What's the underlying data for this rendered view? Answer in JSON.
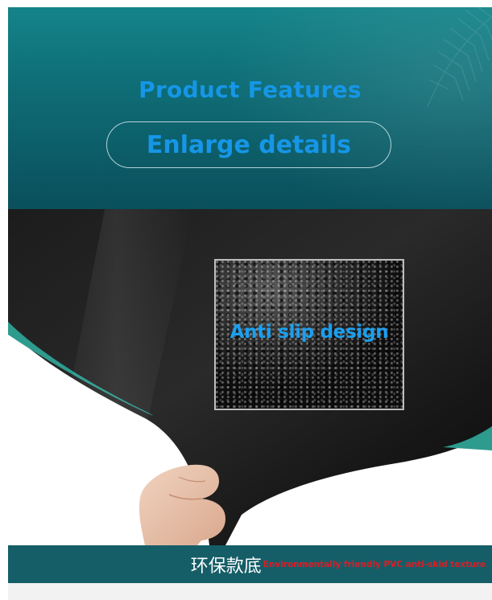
{
  "header": {
    "title": "Product Features",
    "pill_label": "Enlarge details"
  },
  "photo": {
    "inset_label": "Anti slip design"
  },
  "caption": {
    "chinese_text": "环保款底",
    "english_text": "Environmentally friendly PVC anti-skid texture"
  },
  "colors": {
    "header_teal": "#0f6f78",
    "accent_blue": "#1696e6",
    "caption_bar": "#155e68",
    "caption_red": "#e01b24"
  },
  "icons": {
    "decoration": "palm-leaf-icon"
  }
}
